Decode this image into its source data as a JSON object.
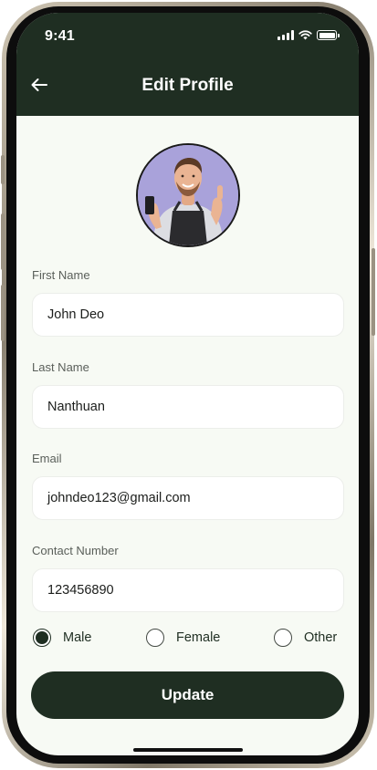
{
  "status_bar": {
    "time": "9:41"
  },
  "header": {
    "title": "Edit Profile",
    "back_icon": "arrow-left-icon"
  },
  "avatar": {
    "background": "#a9a2da",
    "description_icon": "profile-photo"
  },
  "form": {
    "first_name": {
      "label": "First Name",
      "value": "John Deo"
    },
    "last_name": {
      "label": "Last Name",
      "value": "Nanthuan"
    },
    "email": {
      "label": "Email",
      "value": "johndeo123@gmail.com"
    },
    "contact": {
      "label": "Contact Number",
      "value": "123456890"
    }
  },
  "gender": {
    "selected": "Male",
    "options": [
      {
        "label": "Male",
        "checked": true
      },
      {
        "label": "Female",
        "checked": false
      },
      {
        "label": "Other",
        "checked": false
      }
    ]
  },
  "actions": {
    "update_label": "Update"
  },
  "colors": {
    "primary": "#1f2e22",
    "screen_bg": "#f7faf4",
    "input_bg": "#ffffff"
  }
}
